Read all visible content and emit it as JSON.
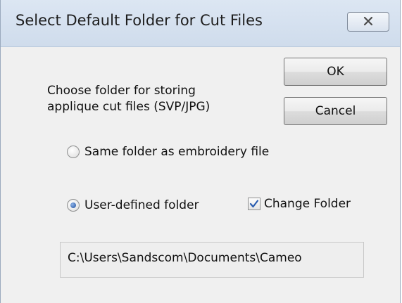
{
  "window": {
    "title": "Select Default Folder for Cut Files",
    "close_icon": "close-x-icon"
  },
  "description": {
    "line1": "Choose folder for storing",
    "line2": "applique cut files (SVP/JPG)"
  },
  "buttons": {
    "ok_label": "OK",
    "cancel_label": "Cancel"
  },
  "options": {
    "same_folder_label": "Same folder as embroidery file",
    "same_folder_selected": false,
    "user_defined_label": "User-defined folder",
    "user_defined_selected": true,
    "change_folder_label": "Change Folder",
    "change_folder_checked": true
  },
  "folder_path": "C:\\Users\\Sandscom\\Documents\\Cameo",
  "colors": {
    "title_bar": "#cfdcec",
    "dialog_bg": "#f0f0f0",
    "accent_check": "#2a5db0"
  }
}
